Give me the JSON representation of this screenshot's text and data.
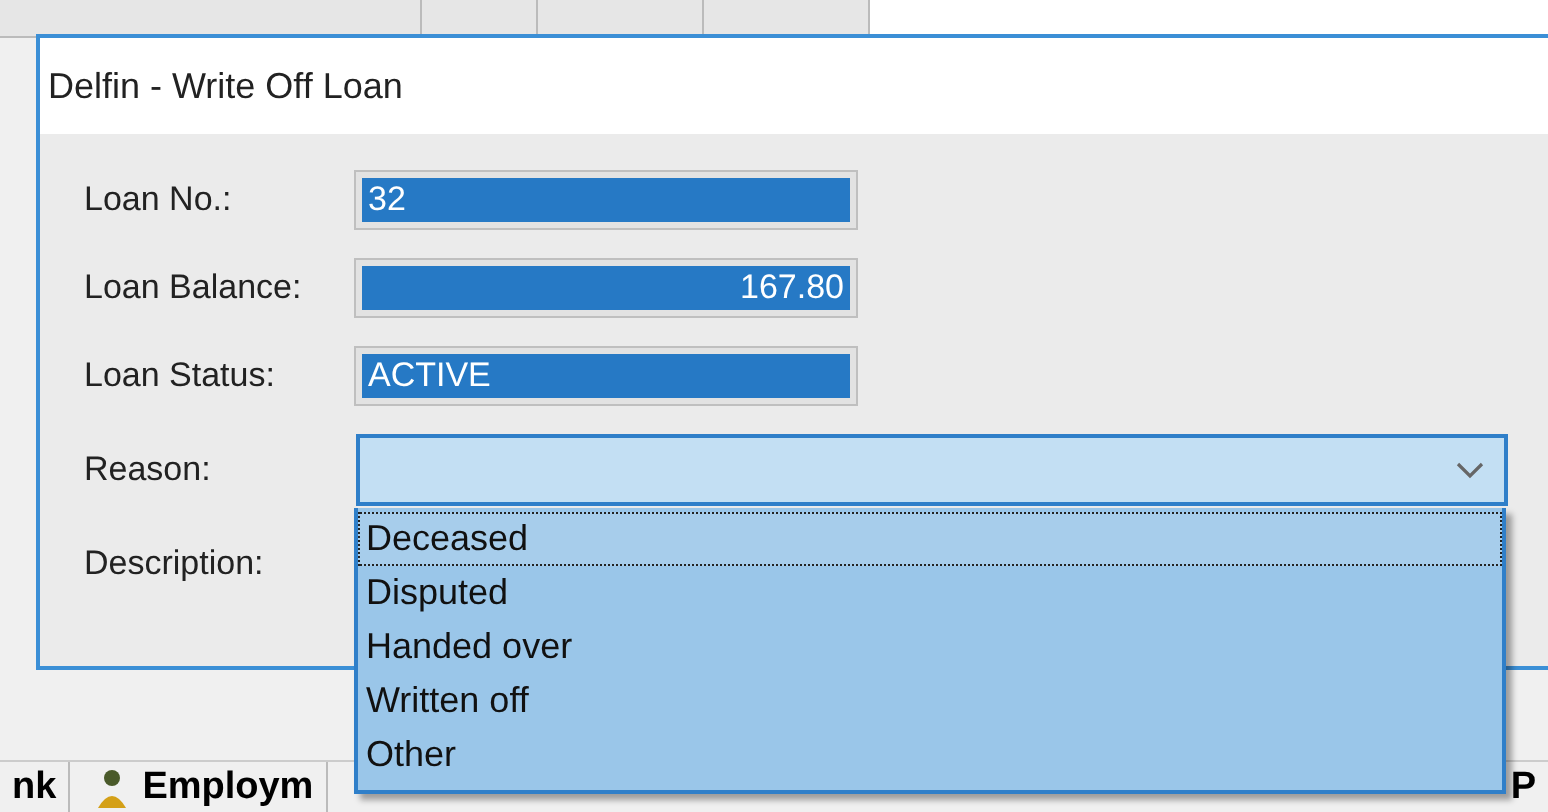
{
  "background_tabs": [
    {
      "label": "nk"
    },
    {
      "label": "Employm"
    },
    {
      "label": "P"
    }
  ],
  "dialog": {
    "title": "Delfin - Write Off Loan",
    "fields": [
      {
        "label": "Loan No.:",
        "value": "32",
        "kind": "text"
      },
      {
        "label": "Loan Balance:",
        "value": "167.80",
        "kind": "amount"
      },
      {
        "label": "Loan Status:",
        "value": "ACTIVE",
        "kind": "text"
      }
    ],
    "reason": {
      "label": "Reason:",
      "expanded": true,
      "options": [
        {
          "label": "Deceased",
          "selected": true
        },
        {
          "label": "Disputed",
          "selected": false
        },
        {
          "label": "Handed over",
          "selected": false
        },
        {
          "label": "Written off",
          "selected": false
        },
        {
          "label": "Other",
          "selected": false
        }
      ]
    },
    "description": {
      "label": "Description:"
    }
  }
}
